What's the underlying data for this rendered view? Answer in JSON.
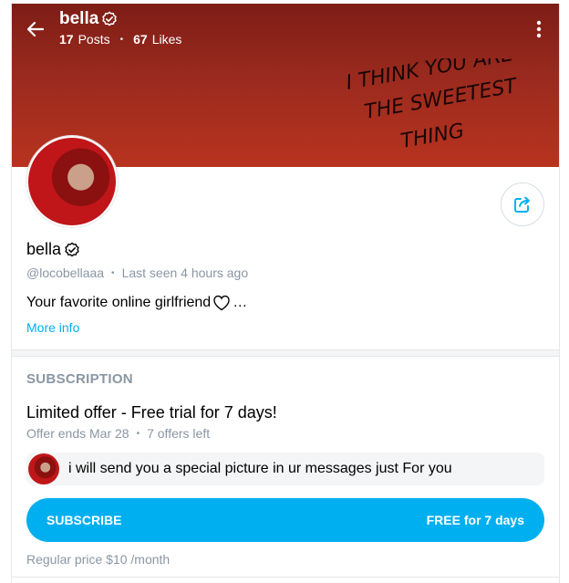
{
  "header": {
    "name": "bella",
    "posts_count": "17",
    "posts_label": "Posts",
    "likes_count": "67",
    "likes_label": "Likes",
    "cover_text_line1": "I THINK YOU ARE",
    "cover_text_line2": "THE SWEETEST",
    "cover_text_line3": "THING",
    "icons": {
      "back": "arrow-left-icon",
      "menu": "more-vertical-icon",
      "verified": "verified-badge-icon"
    }
  },
  "profile": {
    "name": "bella",
    "username": "@locobellaaa",
    "last_seen": "Last seen 4 hours ago",
    "bio": "Your favorite online girlfriend",
    "bio_suffix": "…",
    "more_info": "More info",
    "share_icon": "share-icon"
  },
  "subscription": {
    "section_title": "SUBSCRIPTION",
    "offer_title": "Limited offer - Free trial for 7 days!",
    "offer_ends": "Offer ends Mar 28",
    "offers_left": "7 offers left",
    "message": "i will send you a special picture in ur messages just For you",
    "subscribe_label": "SUBSCRIBE",
    "subscribe_price": "FREE for 7 days",
    "regular_price": "Regular price $10 /month"
  },
  "colors": {
    "accent": "#00aff0",
    "muted_text": "#8a96a3",
    "cover_top": "#7d1d16",
    "cover_bottom": "#b8331f"
  }
}
